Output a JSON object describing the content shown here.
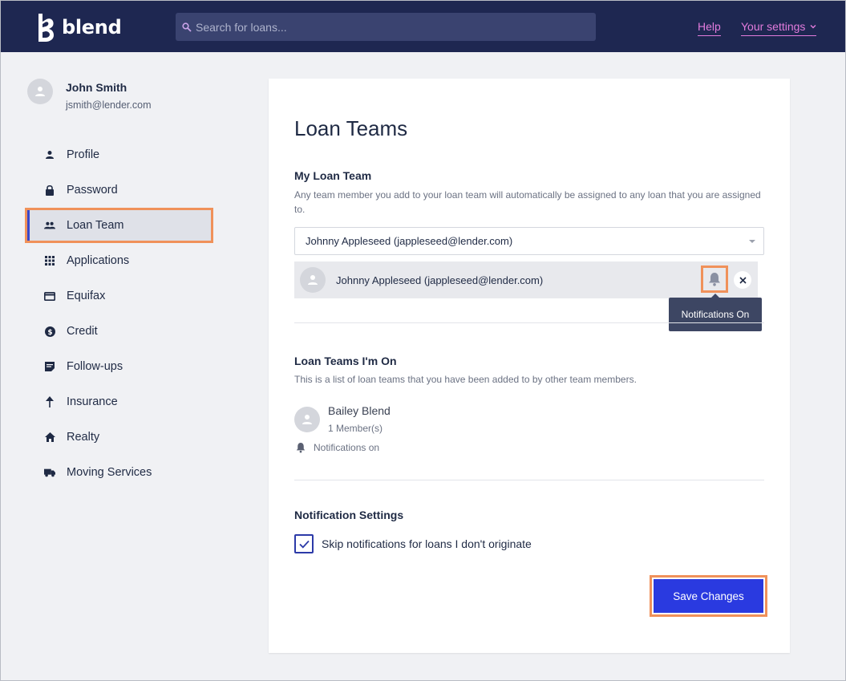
{
  "header": {
    "brand": "blend",
    "search_placeholder": "Search for loans...",
    "help_label": "Help",
    "settings_label": "Your settings"
  },
  "user": {
    "name": "John Smith",
    "email": "jsmith@lender.com"
  },
  "sidebar": {
    "items": [
      {
        "label": "Profile",
        "icon": "person-icon"
      },
      {
        "label": "Password",
        "icon": "lock-icon"
      },
      {
        "label": "Loan Team",
        "icon": "people-icon",
        "active": true
      },
      {
        "label": "Applications",
        "icon": "grid-icon"
      },
      {
        "label": "Equifax",
        "icon": "credit-card-icon"
      },
      {
        "label": "Credit",
        "icon": "dollar-circle-icon"
      },
      {
        "label": "Follow-ups",
        "icon": "note-icon"
      },
      {
        "label": "Insurance",
        "icon": "umbrella-icon"
      },
      {
        "label": "Realty",
        "icon": "house-icon"
      },
      {
        "label": "Moving Services",
        "icon": "truck-icon"
      }
    ]
  },
  "main": {
    "title": "Loan Teams",
    "my_team": {
      "heading": "My Loan Team",
      "description": "Any team member you add to your loan team will automatically be assigned to any loan that you are assigned to.",
      "select_value": "Johnny Appleseed (jappleseed@lender.com)",
      "member_name": "Johnny Appleseed (jappleseed@lender.com)",
      "tooltip": "Notifications On"
    },
    "teams_on": {
      "heading": "Loan Teams I'm On",
      "description": "This is a list of loan teams that you have been added to by other team members.",
      "team_name": "Bailey Blend",
      "team_count": "1 Member(s)",
      "notif_label": "Notifications on"
    },
    "notification_settings": {
      "heading": "Notification Settings",
      "checkbox_label": "Skip notifications for loans I don't originate",
      "checked": true
    },
    "save_label": "Save Changes"
  },
  "colors": {
    "header_bg": "#1e2751",
    "accent_link": "#e27bdc",
    "primary_button": "#2a3ae0",
    "highlight_outline": "#f0915a"
  }
}
